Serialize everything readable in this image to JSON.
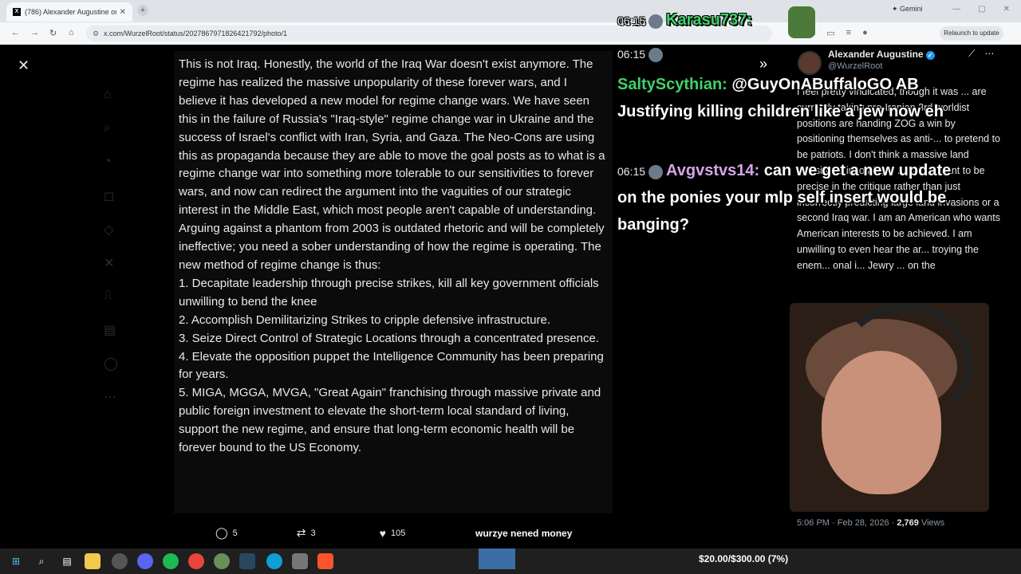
{
  "browser": {
    "tab_title": "(786) Alexander Augustine on X",
    "url": "x.com/WurzelRoot/status/2027867971826421792/photo/1",
    "gemini_label": "Gemini",
    "relaunch_label": "Relaunch to update"
  },
  "article": {
    "paragraphs": [
      "This is not Iraq. Honestly, the world of the Iraq War doesn't exist anymore. The regime has realized the massive unpopularity of these forever wars, and I believe it has developed a new model for regime change wars. We have seen this in the failure of Russia's \"Iraq-style\" regime change war in Ukraine and the success of Israel's conflict with Iran, Syria, and Gaza. The Neo-Cons are using this as propaganda because they are able to move the goal posts as to what is a regime change war into something more tolerable to our sensitivities to forever wars, and now can redirect the argument into the vaguities of our strategic interest in the Middle East, which most people aren't capable of understanding. Arguing against a phantom from 2003 is outdated rhetoric and will be completely ineffective; you need a sober understanding of how the regime is operating. The new method of regime change is thus:",
      "1. Decapitate leadership through precise strikes, kill all key government officials unwilling to bend the knee",
      "2. Accomplish Demilitarizing Strikes to cripple defensive infrastructure.",
      "3. Seize Direct Control of Strategic Locations through a concentrated presence.",
      "4. Elevate the opposition puppet the Intelligence Community has been preparing for years.",
      "5. MIGA, MGGA, MVGA, \"Great Again\" franchising through massive private and public foreign investment to elevate the short-term local standard of living, support the new regime, and ensure that long-term economic health will be forever bound to the US Economy."
    ]
  },
  "actions": {
    "replies": "5",
    "reposts": "3",
    "likes": "105"
  },
  "sidebar": {
    "author_name": "Alexander Augustine",
    "author_handle": "@WurzelRoot",
    "reply_text": "I feel pretty vindicated, though it was ... are currently taking pro-Iranian 3rd worldist positions are handing ZOG a win by positioning themselves as anti-... to pretend to be patriots. I don't think a massive land invasion is incoming. I ... is important to be precise in the critique rather than just incorrectly predicting large land invasions or a second Iraq war. I am an American who wants American interests to be achieved. I am unwilling to even hear the ar... troying the enem... onal i... Jewry ... on the",
    "timestamp": "5:06 PM · Feb 28, 2026",
    "views_count": "2,769",
    "views_label": "Views"
  },
  "chat": [
    {
      "time": "06:15",
      "user": "Karasu737",
      "message": ""
    },
    {
      "time": "06:15",
      "user": "SaltyScythian",
      "message": "@GuyOnABuffaloGO AB Justifying killing children like a jew now eh"
    },
    {
      "time": "06:15",
      "user": "Avgvstvs14",
      "message": "can we get a new update on the ponies your mlp self insert would be banging?"
    }
  ],
  "overlay": {
    "label": "wurzye nened money",
    "donation": "$20.00/$300.00 (7%)"
  }
}
